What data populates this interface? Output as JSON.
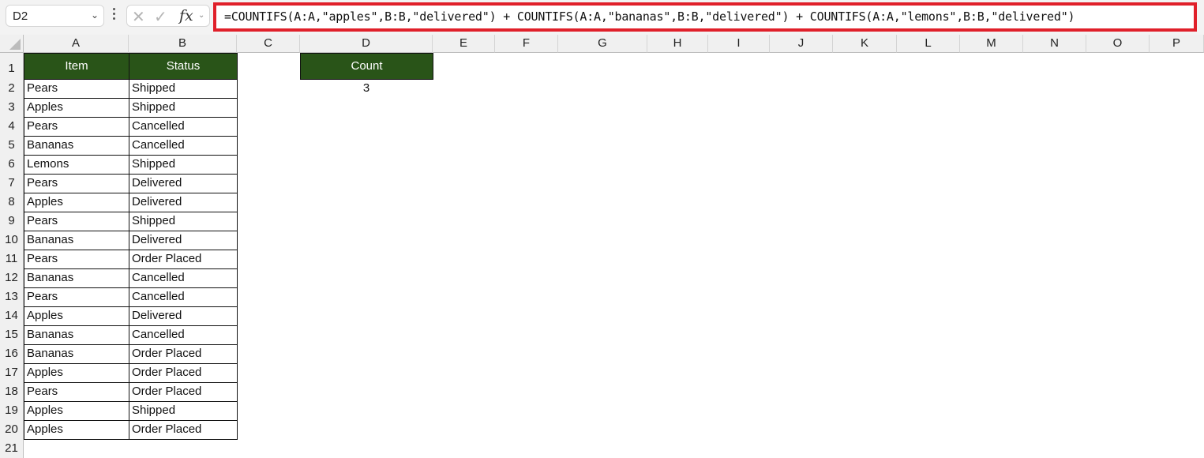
{
  "toolbar": {
    "name_box": "D2",
    "cancel_icon": "✕",
    "confirm_icon": "✓",
    "fx_label": "fx",
    "formula": "=COUNTIFS(A:A,\"apples\",B:B,\"delivered\") + COUNTIFS(A:A,\"bananas\",B:B,\"delivered\") + COUNTIFS(A:A,\"lemons\",B:B,\"delivered\")"
  },
  "columns": [
    "A",
    "B",
    "C",
    "D",
    "E",
    "F",
    "G",
    "H",
    "I",
    "J",
    "K",
    "L",
    "M",
    "N",
    "O",
    "P"
  ],
  "rows": [
    "1",
    "2",
    "3",
    "4",
    "5",
    "6",
    "7",
    "8",
    "9",
    "10",
    "11",
    "12",
    "13",
    "14",
    "15",
    "16",
    "17",
    "18",
    "19",
    "20",
    "21"
  ],
  "table": {
    "headers": [
      "Item",
      "Status"
    ],
    "rows": [
      [
        "Pears",
        "Shipped"
      ],
      [
        "Apples",
        "Shipped"
      ],
      [
        "Pears",
        "Cancelled"
      ],
      [
        "Bananas",
        "Cancelled"
      ],
      [
        "Lemons",
        "Shipped"
      ],
      [
        "Pears",
        "Delivered"
      ],
      [
        "Apples",
        "Delivered"
      ],
      [
        "Pears",
        "Shipped"
      ],
      [
        "Bananas",
        "Delivered"
      ],
      [
        "Pears",
        "Order Placed"
      ],
      [
        "Bananas",
        "Cancelled"
      ],
      [
        "Pears",
        "Cancelled"
      ],
      [
        "Apples",
        "Delivered"
      ],
      [
        "Bananas",
        "Cancelled"
      ],
      [
        "Bananas",
        "Order Placed"
      ],
      [
        "Apples",
        "Order Placed"
      ],
      [
        "Pears",
        "Order Placed"
      ],
      [
        "Apples",
        "Shipped"
      ],
      [
        "Apples",
        "Order Placed"
      ]
    ]
  },
  "count": {
    "header": "Count",
    "value": "3"
  },
  "colors": {
    "header_fill": "#295418",
    "highlight_border": "#e0202a"
  }
}
